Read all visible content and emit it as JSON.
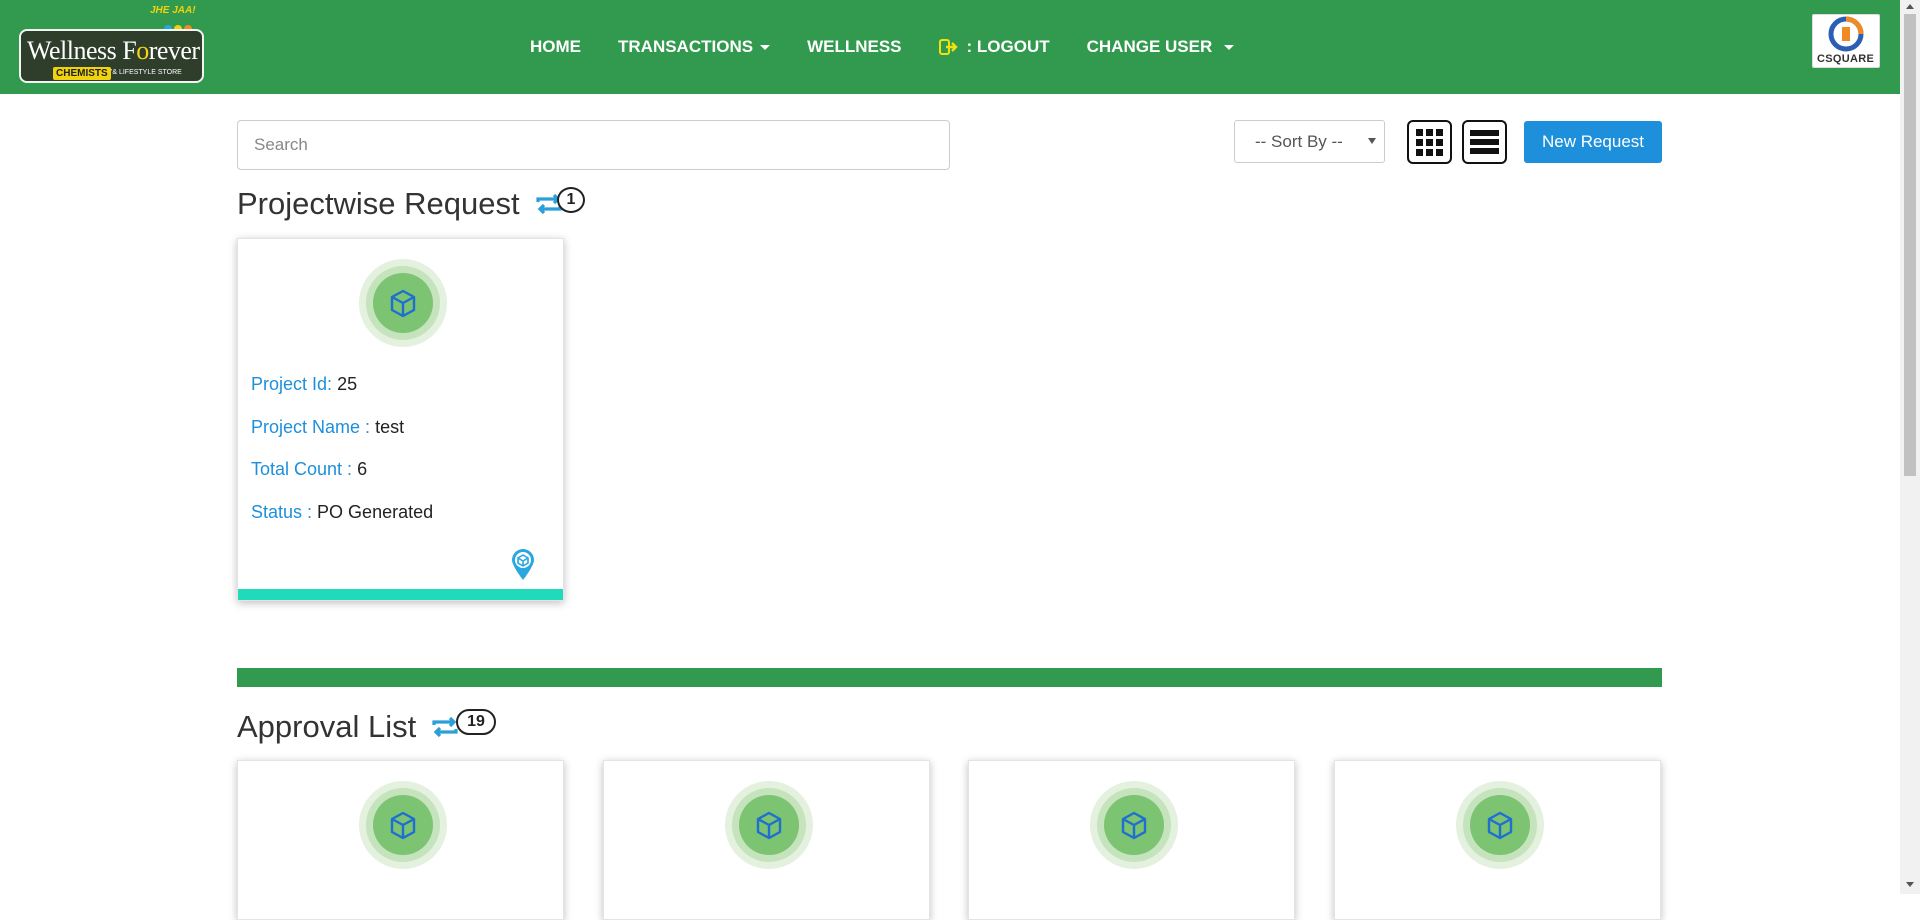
{
  "brand": {
    "logo_text_1": "Wellness F",
    "logo_text_2": "o",
    "logo_text_3": "rever",
    "logo_badge": "CHEMISTS",
    "logo_sub": "'& LIFESTYLE STORE",
    "logo_tag": "JHE JAA!",
    "partner_logo": "CSQUARE"
  },
  "nav": {
    "home": "HOME",
    "transactions": "TRANSACTIONS",
    "wellness": "WELLNESS",
    "logout": ": LOGOUT",
    "change_user": "CHANGE USER"
  },
  "toolbar": {
    "search_placeholder": "Search",
    "sort_label": "-- Sort By --",
    "new_request": "New Request",
    "grid_view_icon": "grid-icon",
    "list_view_icon": "list-icon"
  },
  "projectwise": {
    "title": "Projectwise Request",
    "count": "1",
    "cards": [
      {
        "project_id_label": "Project Id:",
        "project_id": "25",
        "project_name_label": "Project Name :",
        "project_name": "test",
        "total_count_label": "Total Count :",
        "total_count": "6",
        "status_label": "Status :",
        "status": "PO Generated"
      }
    ]
  },
  "approval": {
    "title": "Approval List",
    "count": "19"
  },
  "colors": {
    "primary_green": "#329a4f",
    "accent_blue": "#1d8fdb",
    "card_bar": "#1fdbb9"
  }
}
